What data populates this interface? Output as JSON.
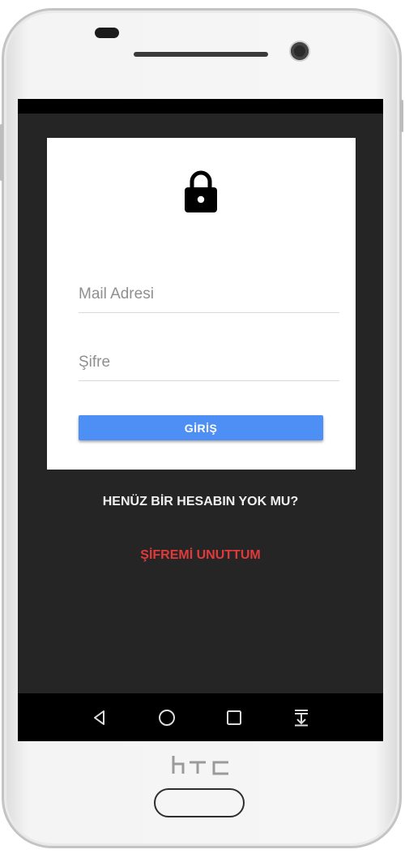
{
  "device": {
    "brand_logo": "htc"
  },
  "login": {
    "lock_icon": "lock-icon",
    "email_placeholder": "Mail Adresi",
    "password_placeholder": "Şifre",
    "submit_label": "GİRİŞ",
    "accent_color": "#4d8ff4"
  },
  "links": {
    "signup": "HENÜZ BİR HESABIN YOK MU?",
    "forgot_password": "ŞİFREMİ UNUTTUM",
    "forgot_color": "#e23a3a"
  },
  "navbar": {
    "icons": [
      "back-icon",
      "home-icon",
      "recents-icon",
      "notification-pull-icon"
    ]
  }
}
